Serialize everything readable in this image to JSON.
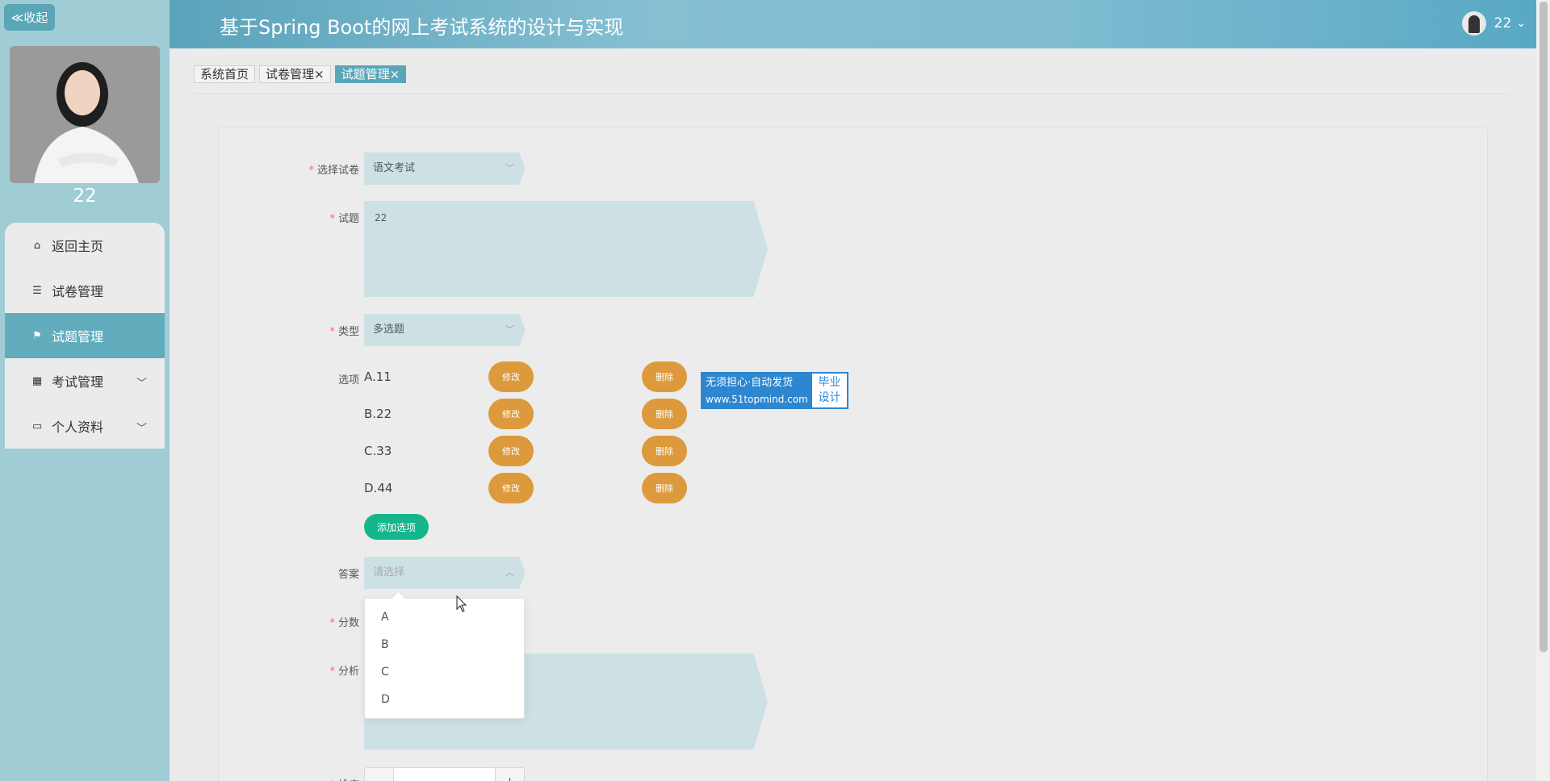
{
  "sidebar": {
    "collapse_label": "≪收起",
    "username": "22",
    "menu": [
      {
        "label": "返回主页",
        "icon": "home-icon",
        "glyph": "⌂",
        "active": false,
        "expandable": false
      },
      {
        "label": "试卷管理",
        "icon": "list-icon",
        "glyph": "☰",
        "active": false,
        "expandable": false
      },
      {
        "label": "试题管理",
        "icon": "flag-icon",
        "glyph": "⚑",
        "active": true,
        "expandable": false
      },
      {
        "label": "考试管理",
        "icon": "grid-icon",
        "glyph": "▦",
        "active": false,
        "expandable": true
      },
      {
        "label": "个人资料",
        "icon": "wallet-icon",
        "glyph": "▭",
        "active": false,
        "expandable": true
      }
    ]
  },
  "header": {
    "title": "基于Spring Boot的网上考试系统的设计与实现",
    "user_name": "22",
    "dropdown_glyph": "⌄"
  },
  "tabs": [
    {
      "label": "系统首页",
      "closable": false,
      "active": false
    },
    {
      "label": "试卷管理",
      "closable": true,
      "active": false
    },
    {
      "label": "试题管理",
      "closable": true,
      "active": true
    }
  ],
  "form": {
    "paper": {
      "label": "选择试卷",
      "required": true,
      "value": "语文考试"
    },
    "question": {
      "label": "试题",
      "required": true,
      "value": "22"
    },
    "type": {
      "label": "类型",
      "required": true,
      "value": "多选题"
    },
    "options_label": "选项",
    "options": [
      {
        "text": "A.11",
        "edit_label": "修改",
        "delete_label": "删除"
      },
      {
        "text": "B.22",
        "edit_label": "修改",
        "delete_label": "删除"
      },
      {
        "text": "C.33",
        "edit_label": "修改",
        "delete_label": "删除"
      },
      {
        "text": "D.44",
        "edit_label": "修改",
        "delete_label": "删除"
      }
    ],
    "add_option_label": "添加选项",
    "answer": {
      "label": "答案",
      "required": false,
      "placeholder": "请选择",
      "dropdown_options": [
        "A",
        "B",
        "C",
        "D"
      ]
    },
    "score": {
      "label": "分数",
      "required": true
    },
    "analysis": {
      "label": "分析",
      "required": true
    },
    "sort": {
      "label": "排序",
      "required": true,
      "minus": "−",
      "plus": "+"
    }
  },
  "watermark": {
    "line1": "无须担心·自动发货",
    "line2": "www.51topmind.com",
    "right1": "毕业",
    "right2": "设计"
  },
  "colors": {
    "sidebar_bg": "#9fccd5",
    "active_menu": "#63acbe",
    "pill_orange": "#dc9a3c",
    "add_green": "#14b68b",
    "required_red": "#f56c6c"
  }
}
